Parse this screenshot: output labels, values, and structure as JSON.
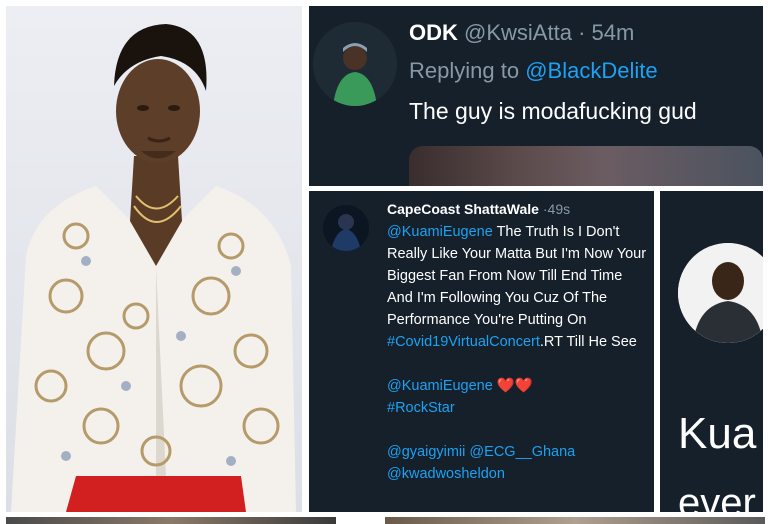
{
  "tweet_top": {
    "display_name": "ODK",
    "handle": "@KwsiAtta",
    "separator": "·",
    "time": "54m",
    "replying_prefix": "Replying to ",
    "replying_to": "@BlackDelite",
    "text": "The guy is modafucking gud"
  },
  "tweet_mid": {
    "display_name": "CapeCoast ShattaWale",
    "separator": "·",
    "time": "49s",
    "mention_1": "@KuamiEugene",
    "text_1": " The Truth Is I Don't Really Like Your Matta But I'm Now Your Biggest Fan From Now Till End Time And I'm Following You Cuz Of The Performance You're Putting On ",
    "hashtag_1": "#Covid19VirtualConcert",
    "text_2": ".RT Till He See",
    "mention_2": "@KuamiEugene",
    "hearts": " ❤️❤️",
    "hashtag_2": "#RockStar",
    "mention_3": "@gyaigyimii",
    "mention_4": "@ECG__Ghana",
    "mention_5": "@kwadwosheldon"
  },
  "tweet_right": {
    "text_1": "Kua",
    "text_2": "ever"
  },
  "colors": {
    "tweet_bg": "#15202b",
    "link": "#1da1f2",
    "muted": "#8899a6",
    "shirt_red": "#d21f1f"
  }
}
